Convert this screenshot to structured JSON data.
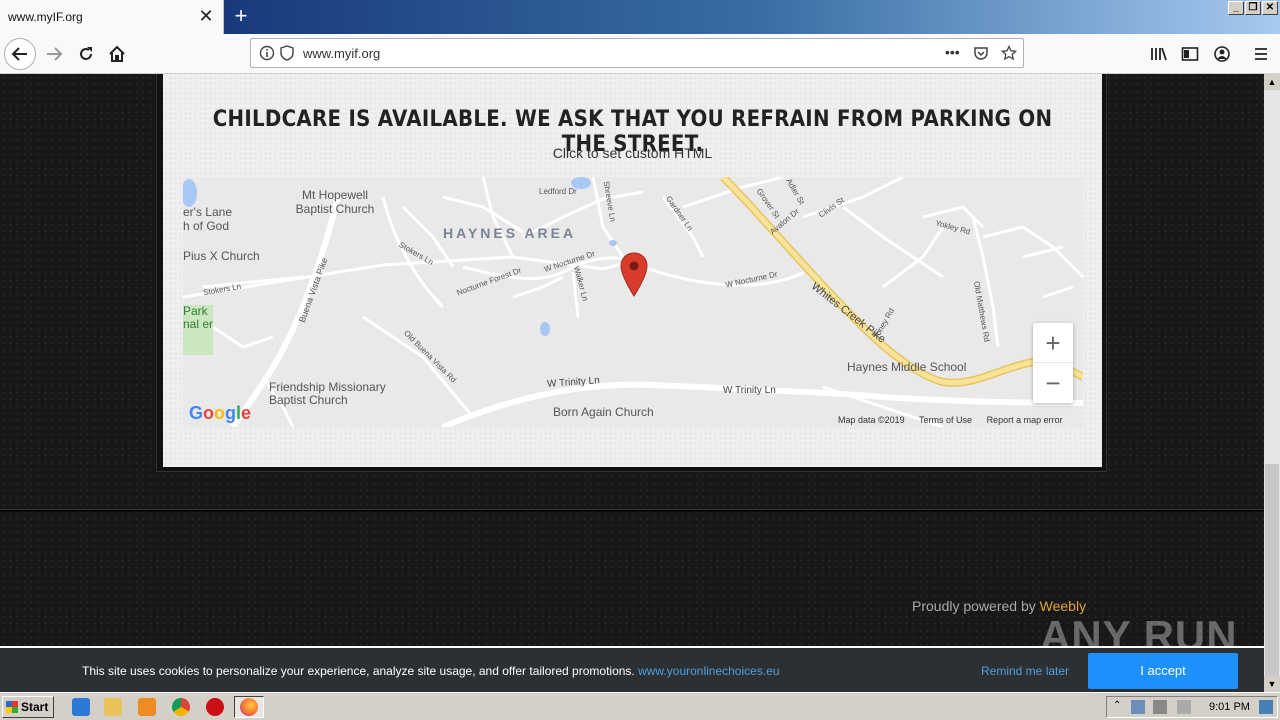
{
  "browser": {
    "tab_title": "www.myIF.org",
    "tab_close": "✕",
    "new_tab": "+",
    "url": "www.myif.org",
    "url_more": "•••"
  },
  "page": {
    "headline": "CHILDCARE IS AVAILABLE. WE ASK THAT YOU REFRAIN FROM PARKING ON THE STREET.",
    "custom_html": "Click to set custom HTML",
    "powered_prefix": "Proudly powered by ",
    "powered_brand": "Weebly"
  },
  "map": {
    "area_label": "HAYNES AREA",
    "places": [
      "Mt Hopewell Baptist Church",
      "Pius X Church",
      "Friendship Missionary Baptist Church",
      "Born Again Church",
      "Haynes Middle School",
      "er's Lane h of God",
      "Park nal er"
    ],
    "roads": [
      "Whites Creek Pike",
      "W Trinity Ln",
      "W Nocturne Dr",
      "Buena Vista Pike",
      "Old Buena Vista Rd",
      "Stokers Ln",
      "Ledford Dr",
      "Yokley Rd",
      "Old Matthews Rd",
      "Nocturne Forest Dr",
      "Gardner Ln",
      "Shreeve Ln",
      "Walker Ln",
      "Grover St",
      "Adler St",
      "Avalon Dr",
      "Clivis St",
      "Toney Rd"
    ],
    "zoom_in": "+",
    "zoom_out": "−",
    "footer": {
      "data": "Map data ©2019",
      "terms": "Terms of Use",
      "report": "Report a map error"
    },
    "logo": "Google"
  },
  "cookie": {
    "text": "This site uses cookies to personalize your experience, analyze site usage, and offer tailored promotions. ",
    "link": "www.youronlinechoices.eu",
    "remind": "Remind me later",
    "accept": "I accept"
  },
  "watermark": "ANY RUN",
  "taskbar": {
    "start": "Start",
    "clock": "9:01 PM"
  },
  "colors": {
    "accent": "#1e90ff",
    "weebly": "#e3a33b",
    "pin": "#d93b2c",
    "highway": "#f4d77a"
  }
}
